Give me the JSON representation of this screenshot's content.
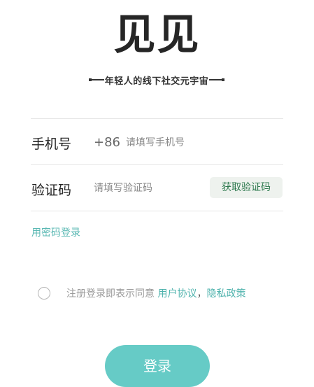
{
  "brand": {
    "logo_text": "见见",
    "slogan": "年轻人的线下社交元宇宙"
  },
  "phone_row": {
    "label": "手机号",
    "country_code": "+86",
    "placeholder": "请填写手机号",
    "value": ""
  },
  "code_row": {
    "label": "验证码",
    "placeholder": "请填写验证码",
    "value": "",
    "get_code_label": "获取验证码"
  },
  "password_login_link": "用密码登录",
  "agreement": {
    "checked": false,
    "prefix": "注册登录即表示同意",
    "user_agreement": "用户协议",
    "separator": "，",
    "privacy_policy": "隐私政策"
  },
  "login_button": "登录",
  "colors": {
    "accent": "#66cbc6",
    "link": "#5ab8b3",
    "code_button_bg": "#eef2ee",
    "code_button_text": "#2f7a4f",
    "logo": "#262626"
  },
  "icons": {
    "checkbox": "radio-circle-icon"
  }
}
